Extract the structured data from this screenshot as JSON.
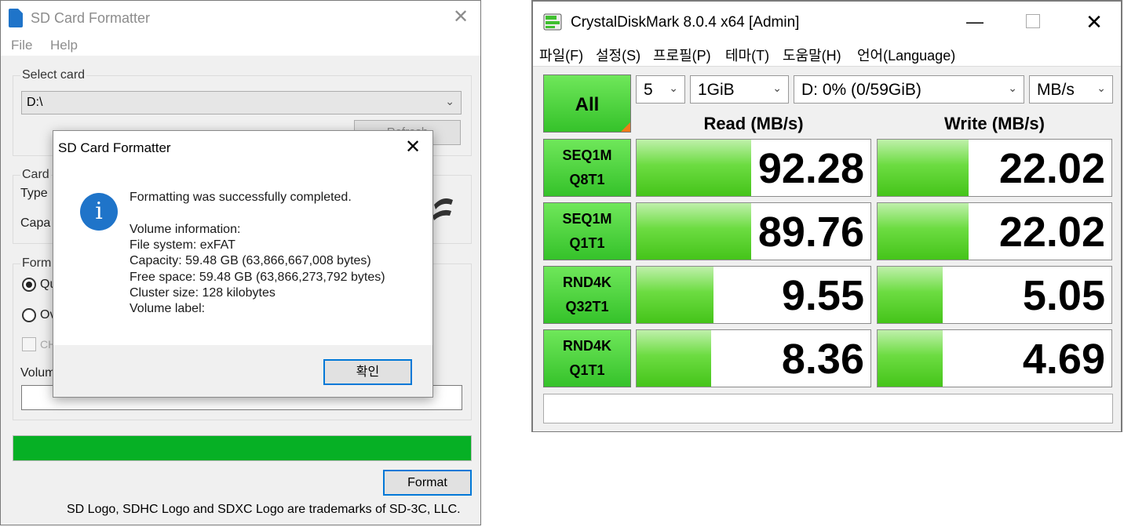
{
  "sd_formatter": {
    "title": "SD Card Formatter",
    "menu": [
      "File",
      "Help"
    ],
    "select_card_label": "Select card",
    "selected_card": "D:\\",
    "refresh_label": "Refresh",
    "card_group_label": "Card",
    "type_label": "Type",
    "capacity_label": "Capa",
    "format_group_label": "Form",
    "quick_label": "Qu",
    "overwrite_label": "Ov",
    "chs_label": "CH",
    "volume_label_text": "Volum",
    "progress": 1.0,
    "format_button": "Format",
    "trademark": "SD Logo, SDHC Logo and SDXC Logo are trademarks of SD-3C, LLC.",
    "colors": {
      "progress": "#06b025",
      "accent": "#0078d7"
    }
  },
  "dialog": {
    "title": "SD Card Formatter",
    "message": "Formatting was successfully completed.",
    "lines": [
      "Volume information:",
      "File system: exFAT",
      "Capacity: 59.48 GB (63,866,667,008 bytes)",
      "Free space: 59.48 GB (63,866,273,792 bytes)",
      "Cluster size: 128 kilobytes",
      "Volume label:"
    ],
    "ok_button": "확인",
    "icon": "info-icon"
  },
  "crystaldiskmark": {
    "title": "CrystalDiskMark 8.0.4 x64 [Admin]",
    "menu": [
      "파일(F)",
      "설정(S)",
      "프로필(P)",
      "테마(T)",
      "도움말(H)",
      "언어(Language)"
    ],
    "all_button": "All",
    "count": "5",
    "size": "1GiB",
    "drive": "D: 0% (0/59GiB)",
    "unit": "MB/s",
    "read_header": "Read (MB/s)",
    "write_header": "Write (MB/s)",
    "max_scale": 150,
    "rows": [
      {
        "l1": "SEQ1M",
        "l2": "Q8T1",
        "read": "92.28",
        "write": "22.02",
        "read_fill": 0.49,
        "write_fill": 0.39
      },
      {
        "l1": "SEQ1M",
        "l2": "Q1T1",
        "read": "89.76",
        "write": "22.02",
        "read_fill": 0.49,
        "write_fill": 0.39
      },
      {
        "l1": "RND4K",
        "l2": "Q32T1",
        "read": "9.55",
        "write": "5.05",
        "read_fill": 0.33,
        "write_fill": 0.28
      },
      {
        "l1": "RND4K",
        "l2": "Q1T1",
        "read": "8.36",
        "write": "4.69",
        "read_fill": 0.32,
        "write_fill": 0.28
      }
    ],
    "colors": {
      "green_top": "#6fe75a",
      "green_bottom": "#35c22a"
    }
  }
}
